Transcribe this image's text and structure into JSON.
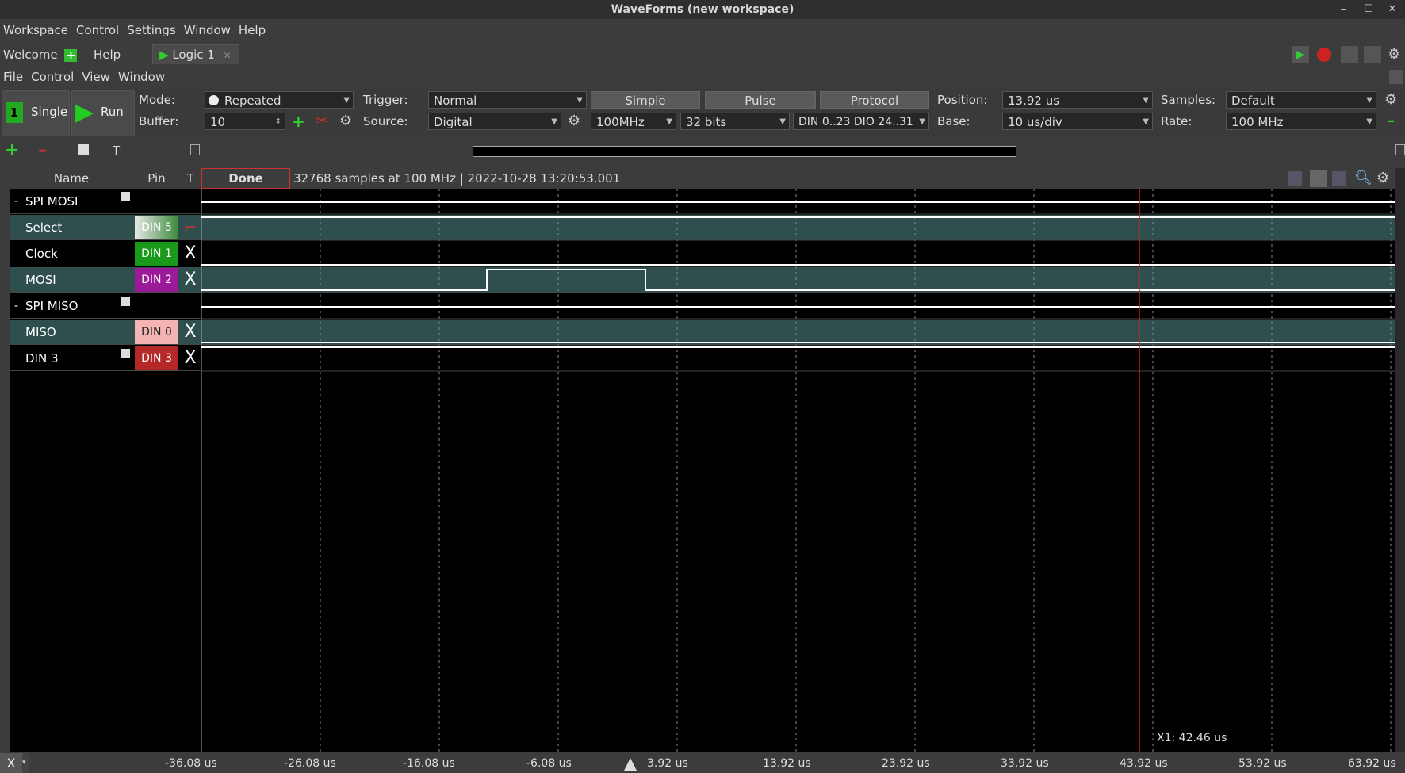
{
  "window": {
    "title": "WaveForms (new workspace)"
  },
  "main_menu": [
    "Workspace",
    "Control",
    "Settings",
    "Window",
    "Help"
  ],
  "workspace_tabs": {
    "welcome": "Welcome",
    "help": "Help",
    "logic": "Logic 1"
  },
  "sub_menu": [
    "File",
    "Control",
    "View",
    "Window"
  ],
  "toolbar": {
    "single_label": "Single",
    "run_label": "Run",
    "mode_label": "Mode:",
    "mode_value": "Repeated",
    "buffer_label": "Buffer:",
    "buffer_value": "10",
    "trigger_label": "Trigger:",
    "trigger_value": "Normal",
    "source_label": "Source:",
    "source_value": "Digital",
    "tabs": [
      "Simple",
      "Pulse",
      "Protocol"
    ],
    "rate_value": "100MHz",
    "bits_value": "32 bits",
    "dio_value": "DIN 0..23 DIO 24..31",
    "position_label": "Position:",
    "position_value": "13.92 us",
    "base_label": "Base:",
    "base_value": "10 us/div",
    "samples_label": "Samples:",
    "samples_value": "Default",
    "rate_label": "Rate:",
    "rate_field_value": "100 MHz"
  },
  "grid": {
    "headers": {
      "name": "Name",
      "pin": "Pin",
      "t": "T"
    },
    "status_badge": "Done",
    "status_text": "32768 samples at 100 MHz | 2022-10-28 13:20:53.001",
    "rows": [
      {
        "name": "SPI MOSI",
        "group": true,
        "prefix": "-"
      },
      {
        "name": "Select",
        "pin": "DIN 5",
        "pin_color": "#5aa05a"
      },
      {
        "name": "Clock",
        "pin": "DIN 1",
        "pin_color": "#1a9a1a"
      },
      {
        "name": "MOSI",
        "pin": "DIN 2",
        "pin_color": "#9a1a9a"
      },
      {
        "name": "SPI MISO",
        "group": true,
        "prefix": "-"
      },
      {
        "name": "MISO",
        "pin": "DIN 0",
        "pin_color": "#f4b4b4"
      },
      {
        "name": "DIN 3",
        "pin": "DIN 3",
        "pin_color": "#b42828"
      }
    ],
    "trigger_mark": "X",
    "cursor_label": "X1: 42.46 us",
    "time_ticks": [
      "-36.08 us",
      "-26.08 us",
      "-16.08 us",
      "-6.08 us",
      "3.92 us",
      "13.92 us",
      "23.92 us",
      "33.92 us",
      "43.92 us",
      "53.92 us",
      "63.92 us"
    ]
  },
  "colors": {
    "accent_green": "#2ea82e",
    "cursor_red": "#d02020",
    "row_teal": "#2f4f4f"
  }
}
